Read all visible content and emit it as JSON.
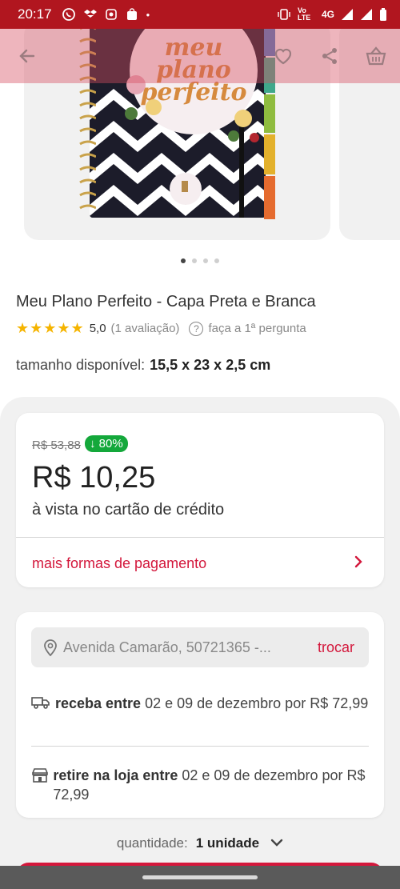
{
  "status_bar": {
    "time": "20:17",
    "network": "4G",
    "volte": "Vo LTE"
  },
  "nav": {
    "back_icon": "arrow-left-icon",
    "favorite_icon": "heart-icon",
    "share_icon": "share-icon",
    "cart_icon": "basket-icon"
  },
  "product_image": {
    "cover_text_line1": "meu",
    "cover_text_line2": "plano",
    "cover_text_line3": "perfeito",
    "dots_total": 4,
    "dots_active": 0
  },
  "product": {
    "title": "Meu Plano Perfeito - Capa Preta e Branca",
    "stars": "★★★★★",
    "rating": "5,0",
    "rating_count": "(1 avaliação)",
    "ask_label": "faça a 1ª pergunta",
    "size_label": "tamanho disponível:",
    "size_value": "15,5 x 23 x 2,5 cm"
  },
  "price_card": {
    "old_price": "R$ 53,88",
    "discount": "↓ 80%",
    "price": "R$ 10,25",
    "price_note": "à vista no cartão de crédito",
    "more_payment": "mais formas de pagamento"
  },
  "shipping": {
    "address": "Avenida Camarão, 50721365 -...",
    "change_label": "trocar",
    "delivery_bold": "receba entre",
    "delivery_text": " 02 e 09 de dezembro por R$ 72,99",
    "pickup_bold": "retire na loja entre",
    "pickup_text": " 02 e 09 de dezembro por R$ 72,99"
  },
  "quantity": {
    "label": "quantidade:",
    "value": "1 unidade"
  },
  "colors": {
    "brand_red": "#d3173b",
    "status_bar": "#b1161f",
    "discount_green": "#14a83b",
    "star": "#f5b400"
  }
}
